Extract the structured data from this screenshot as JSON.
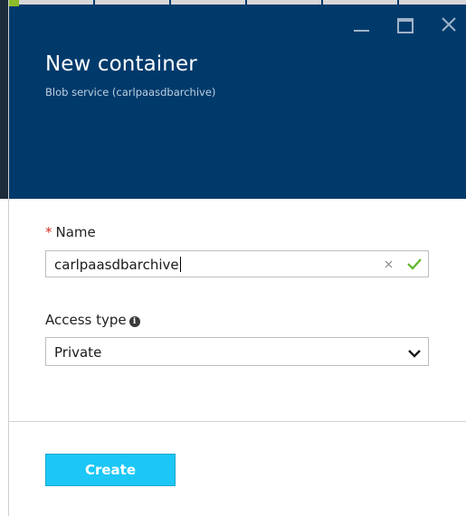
{
  "header": {
    "title": "New container",
    "subtitle": "Blob service (carlpaasdbarchive)",
    "background_color": "#003a6b"
  },
  "window_controls": {
    "minimize_icon": "minimize-icon",
    "maximize_icon": "maximize-icon",
    "close_icon": "close-icon"
  },
  "form": {
    "name": {
      "required_marker": "*",
      "label": "Name",
      "value": "carlpaasdbarchive",
      "valid": true
    },
    "access_type": {
      "label": "Access type",
      "info_icon": "info-icon",
      "selected": "Private"
    }
  },
  "actions": {
    "create_label": "Create",
    "create_color": "#1cc7f5"
  }
}
